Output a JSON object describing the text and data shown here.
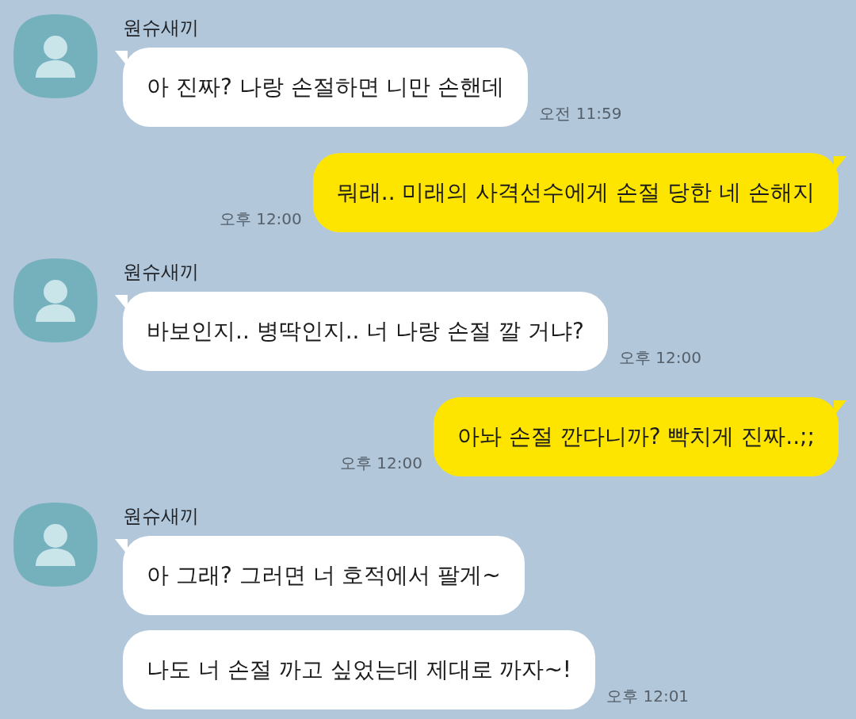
{
  "messages": [
    {
      "kind": "incoming",
      "sender": "원슈새끼",
      "bubbles": [
        "아 진짜? 나랑 손절하면 니만 손핸데"
      ],
      "time": "오전 11:59"
    },
    {
      "kind": "outgoing",
      "bubbles": [
        "뭐래.. 미래의 사격선수에게 손절 당한 네 손해지"
      ],
      "time": "오후 12:00"
    },
    {
      "kind": "incoming",
      "sender": "원슈새끼",
      "bubbles": [
        "바보인지.. 병딱인지.. 너 나랑 손절 깔 거냐?"
      ],
      "time": "오후 12:00"
    },
    {
      "kind": "outgoing",
      "bubbles": [
        "아놔 손절 깐다니까? 빡치게 진짜..;;"
      ],
      "time": "오후 12:00"
    },
    {
      "kind": "incoming",
      "sender": "원슈새끼",
      "bubbles": [
        "아 그래? 그러면 너 호적에서 팔게~",
        "나도 너 손절 까고 싶었는데 제대로 까자~!"
      ],
      "time": "오후 12:01"
    }
  ]
}
